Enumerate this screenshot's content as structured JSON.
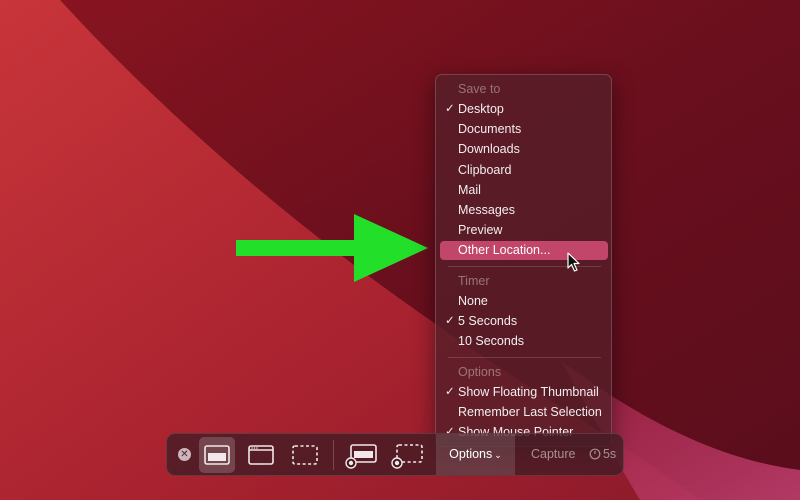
{
  "menu": {
    "save_to": {
      "header": "Save to",
      "items": [
        {
          "label": "Desktop",
          "checked": true
        },
        {
          "label": "Documents",
          "checked": false
        },
        {
          "label": "Downloads",
          "checked": false
        },
        {
          "label": "Clipboard",
          "checked": false
        },
        {
          "label": "Mail",
          "checked": false
        },
        {
          "label": "Messages",
          "checked": false
        },
        {
          "label": "Preview",
          "checked": false
        },
        {
          "label": "Other Location...",
          "checked": false,
          "highlighted": true
        }
      ]
    },
    "timer": {
      "header": "Timer",
      "items": [
        {
          "label": "None",
          "checked": false
        },
        {
          "label": "5 Seconds",
          "checked": true
        },
        {
          "label": "10 Seconds",
          "checked": false
        }
      ]
    },
    "options": {
      "header": "Options",
      "items": [
        {
          "label": "Show Floating Thumbnail",
          "checked": true
        },
        {
          "label": "Remember Last Selection",
          "checked": false
        },
        {
          "label": "Show Mouse Pointer",
          "checked": true
        }
      ]
    },
    "checkmark": "✓"
  },
  "toolbar": {
    "close_glyph": "✕",
    "options_label": "Options",
    "options_chevron": "⌄",
    "capture_label": "Capture",
    "timer_label": "5s",
    "buttons": [
      {
        "icon": "capture-entire-screen-icon",
        "selected": true
      },
      {
        "icon": "capture-selected-window-icon",
        "selected": false
      },
      {
        "icon": "capture-selected-portion-icon",
        "selected": false
      },
      {
        "icon": "record-entire-screen-icon",
        "selected": false
      },
      {
        "icon": "record-selected-portion-icon",
        "selected": false
      }
    ]
  },
  "colors": {
    "wallpaper_dark": "#6e0f1c",
    "wallpaper_light": "#b3262f",
    "highlight": "#c2456a",
    "arrow": "#22e02a"
  }
}
